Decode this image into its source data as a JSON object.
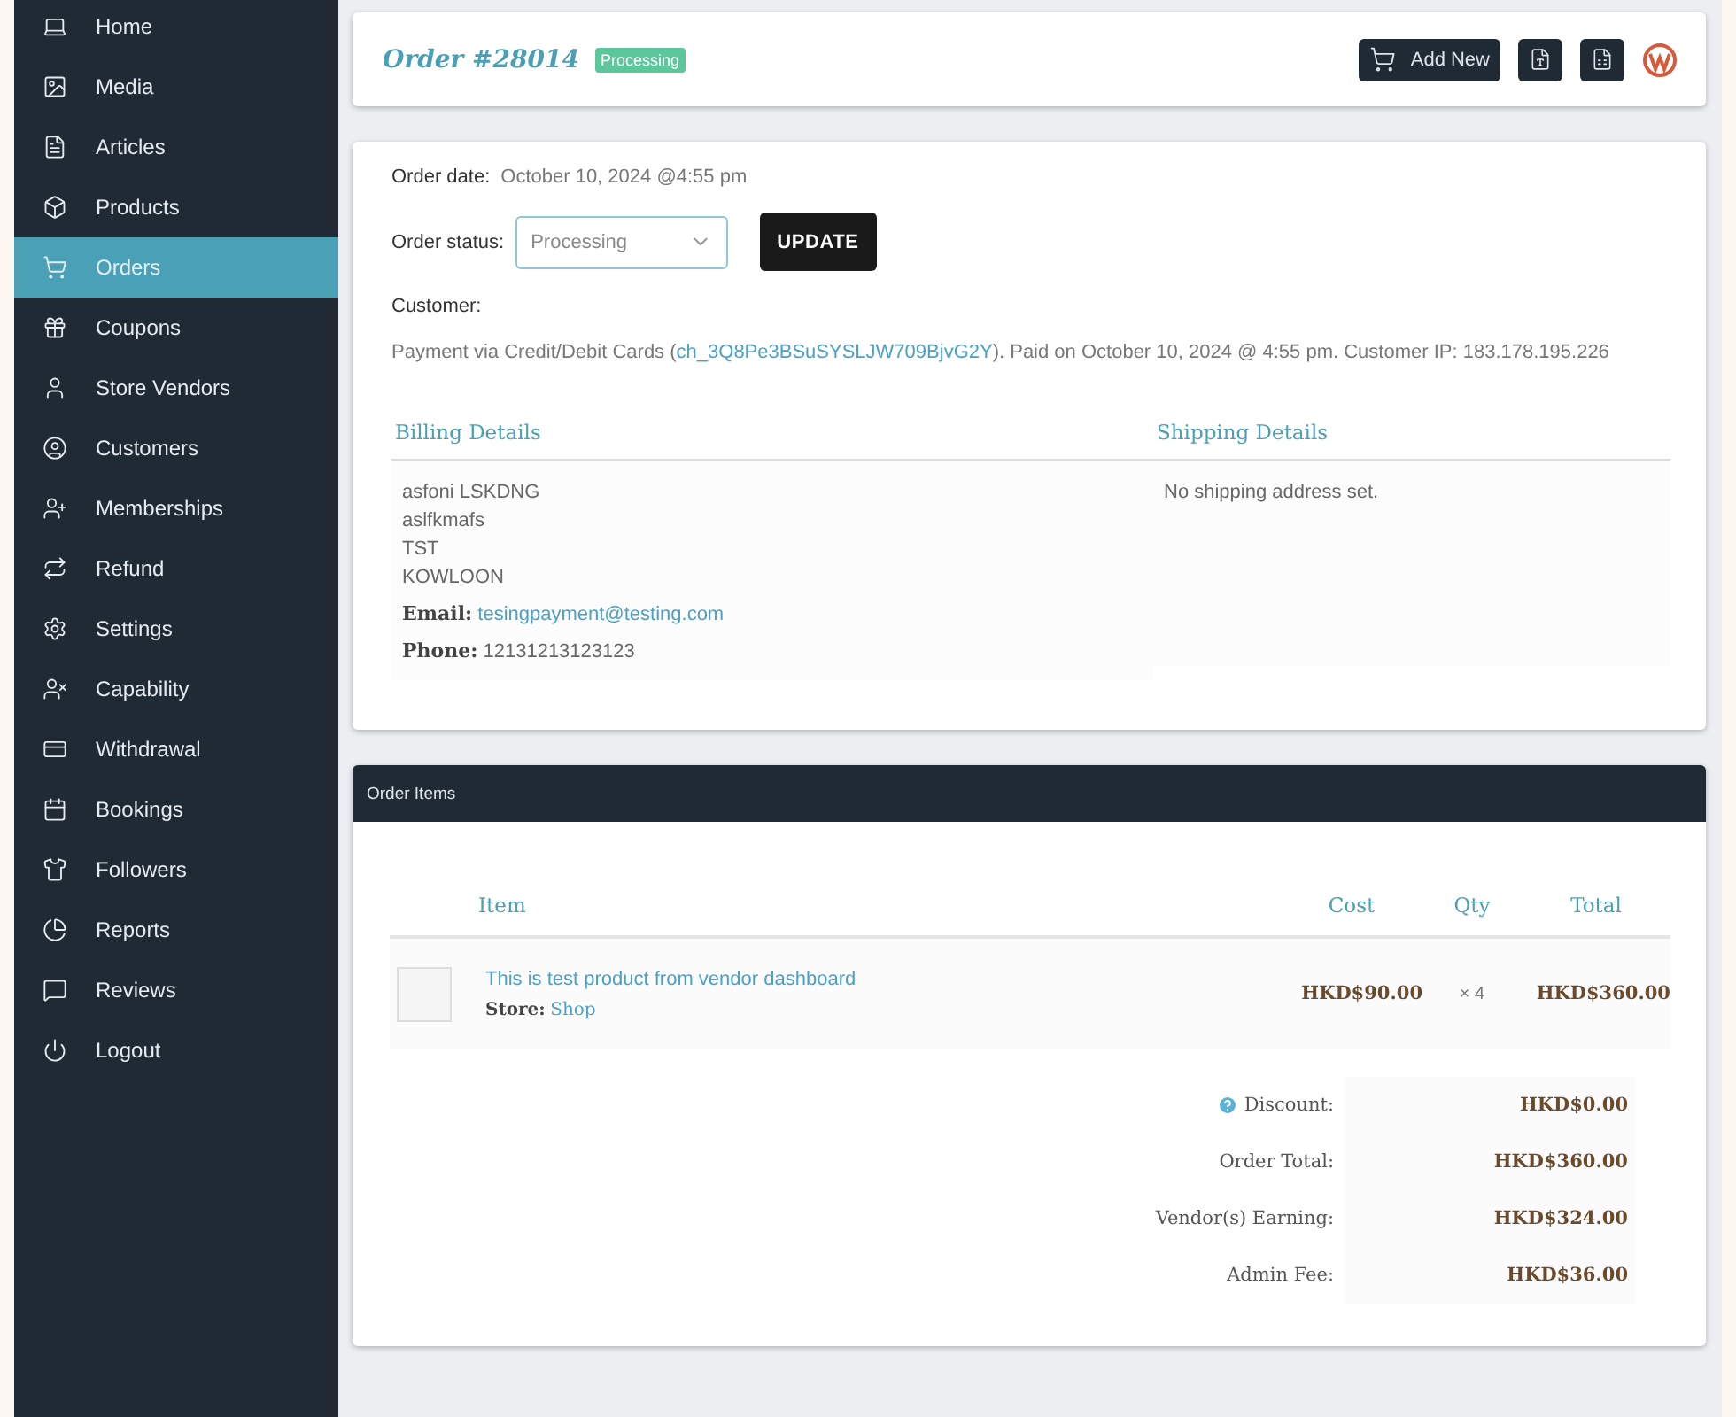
{
  "sidebar": {
    "items": [
      {
        "label": "Home",
        "selected": false
      },
      {
        "label": "Media",
        "selected": false
      },
      {
        "label": "Articles",
        "selected": false
      },
      {
        "label": "Products",
        "selected": false
      },
      {
        "label": "Orders",
        "selected": true
      },
      {
        "label": "Coupons",
        "selected": false
      },
      {
        "label": "Store Vendors",
        "selected": false
      },
      {
        "label": "Customers",
        "selected": false
      },
      {
        "label": "Memberships",
        "selected": false
      },
      {
        "label": "Refund",
        "selected": false
      },
      {
        "label": "Settings",
        "selected": false
      },
      {
        "label": "Capability",
        "selected": false
      },
      {
        "label": "Withdrawal",
        "selected": false
      },
      {
        "label": "Bookings",
        "selected": false
      },
      {
        "label": "Followers",
        "selected": false
      },
      {
        "label": "Reports",
        "selected": false
      },
      {
        "label": "Reviews",
        "selected": false
      },
      {
        "label": "Logout",
        "selected": false
      }
    ]
  },
  "header": {
    "title": "Order #28014",
    "badge": "Processing",
    "add_button": "Add New"
  },
  "order": {
    "date_label": "Order date:",
    "date": "October 10, 2024 @4:55 pm",
    "status_label": "Order status:",
    "status_value": "Processing",
    "update_button": "UPDATE",
    "customer_label": "Customer:",
    "payment": {
      "before": "Payment via Credit/Debit Cards (",
      "link": "ch_3Q8Pe3BSuSYSLJW709BjvG2Y",
      "after": "). Paid on October 10, 2024 @ 4:55 pm. Customer IP: 183.178.195.226"
    },
    "billing": {
      "heading": "Billing Details",
      "lines": [
        "asfoni LSKDNG",
        "aslfkmafs",
        "TST",
        "KOWLOON"
      ],
      "email_label": "Email:",
      "email": "tesingpayment@testing.com",
      "phone_label": "Phone:",
      "phone": "12131213123123"
    },
    "shipping": {
      "heading": "Shipping Details",
      "text": "No shipping address set."
    }
  },
  "items": {
    "title": "Order Items",
    "columns": [
      "Item",
      "Cost",
      "Qty",
      "Total"
    ],
    "rows": [
      {
        "name": "This is test product from vendor dashboard",
        "store_label": "Store:",
        "store": "Shop",
        "cost": "HKD$90.00",
        "qty": "× 4",
        "total": "HKD$360.00"
      }
    ],
    "totals": [
      {
        "label": "Discount:",
        "value": "HKD$0.00",
        "info": true
      },
      {
        "label": "Order Total:",
        "value": "HKD$360.00",
        "info": false
      },
      {
        "label": "Vendor(s) Earning:",
        "value": "HKD$324.00",
        "info": false
      },
      {
        "label": "Admin Fee:",
        "value": "HKD$36.00",
        "info": false
      }
    ]
  }
}
